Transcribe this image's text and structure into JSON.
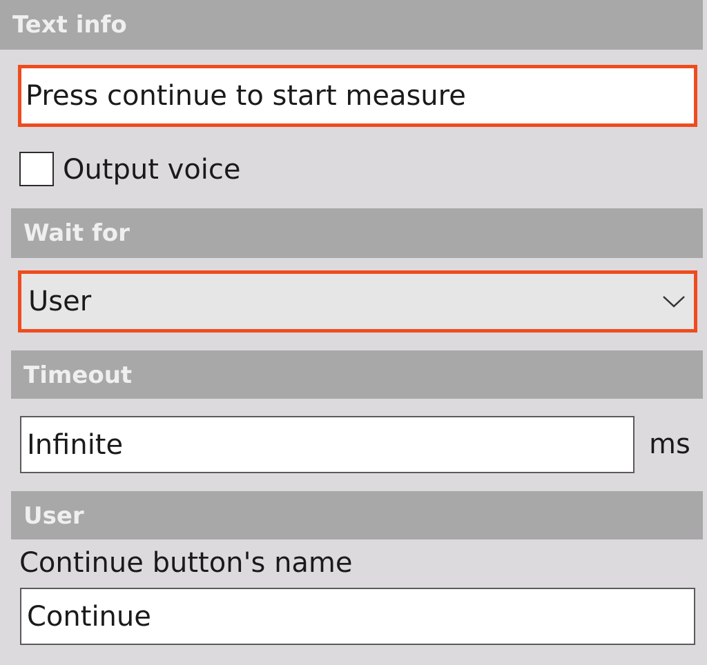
{
  "sections": {
    "text_info": {
      "header": "Text info",
      "text_value": "Press continue to start measure",
      "output_voice_label": "Output voice",
      "output_voice_checked": false
    },
    "wait_for": {
      "header": "Wait for",
      "selected": "User"
    },
    "timeout": {
      "header": "Timeout",
      "value": "Infinite",
      "unit": "ms"
    },
    "user": {
      "header": "User",
      "continue_button_name_label": "Continue button's name",
      "continue_button_name_value": "Continue"
    }
  },
  "icons": {
    "dropdown": "chevron-down-icon"
  },
  "colors": {
    "highlight": "#ee4c1f",
    "header_bg": "#a8a8a8",
    "panel_bg": "#dcdadd"
  }
}
